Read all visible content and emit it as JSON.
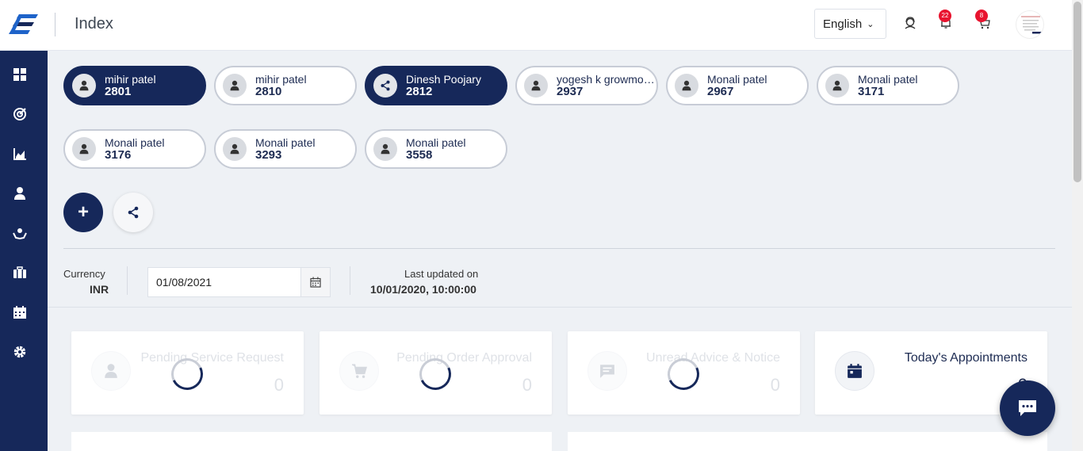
{
  "header": {
    "title": "Index",
    "language": "English",
    "notifications_count": "22",
    "cart_count": "8"
  },
  "sidebar": {
    "items": [
      {
        "icon": "dashboard-icon"
      },
      {
        "icon": "target-icon"
      },
      {
        "icon": "chart-icon"
      },
      {
        "icon": "user-icon"
      },
      {
        "icon": "hands-icon"
      },
      {
        "icon": "briefcase-icon"
      },
      {
        "icon": "calendar-icon"
      },
      {
        "icon": "settings-icon"
      }
    ]
  },
  "accounts": [
    {
      "name": "mihir patel",
      "number": "2801",
      "active": true,
      "icon": "user-icon"
    },
    {
      "name": "mihir patel",
      "number": "2810",
      "active": false,
      "icon": "user-icon"
    },
    {
      "name": "Dinesh Poojary",
      "number": "2812",
      "active": true,
      "icon": "share-icon"
    },
    {
      "name": "yogesh k growmo…",
      "number": "2937",
      "active": false,
      "icon": "user-icon"
    },
    {
      "name": "Monali patel",
      "number": "2967",
      "active": false,
      "icon": "user-icon"
    },
    {
      "name": "Monali patel",
      "number": "3171",
      "active": false,
      "icon": "user-icon"
    },
    {
      "name": "Monali patel",
      "number": "3176",
      "active": false,
      "icon": "user-icon"
    },
    {
      "name": "Monali patel",
      "number": "3293",
      "active": false,
      "icon": "user-icon"
    },
    {
      "name": "Monali patel",
      "number": "3558",
      "active": false,
      "icon": "user-icon"
    }
  ],
  "actions": {
    "add_label": "+"
  },
  "filters": {
    "currency_label": "Currency",
    "currency_value": "INR",
    "date_value": "01/08/2021",
    "last_updated_label": "Last updated on",
    "last_updated_value": "10/01/2020, 10:00:00"
  },
  "cards": [
    {
      "title": "Pending Service Request",
      "value": "0",
      "icon": "user-icon",
      "loading": true
    },
    {
      "title": "Pending Order Approval",
      "value": "0",
      "icon": "cart-icon",
      "loading": true
    },
    {
      "title": "Unread Advice & Notice",
      "value": "0",
      "icon": "message-icon",
      "loading": true
    },
    {
      "title": "Today's Appointments",
      "value": "0",
      "icon": "calendar-icon",
      "loading": false
    }
  ],
  "colors": {
    "primary": "#16285a",
    "badge": "#e8142f",
    "background": "#eef1f5"
  }
}
